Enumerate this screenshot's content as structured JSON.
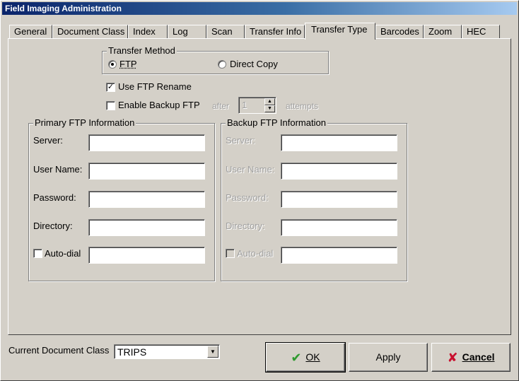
{
  "window": {
    "title": "Field Imaging Administration"
  },
  "tabs": [
    {
      "label": "General"
    },
    {
      "label": "Document Class"
    },
    {
      "label": "Index"
    },
    {
      "label": "Log"
    },
    {
      "label": "Scan"
    },
    {
      "label": "Transfer Info"
    },
    {
      "label": "Transfer Type",
      "active": true
    },
    {
      "label": "Barcodes"
    },
    {
      "label": "Zoom"
    },
    {
      "label": "HEC"
    }
  ],
  "transfer_method": {
    "title": "Transfer Method",
    "options": [
      "FTP",
      "Direct Copy"
    ],
    "selected": "FTP"
  },
  "use_ftp_rename": {
    "label": "Use FTP Rename",
    "checked": true
  },
  "enable_backup": {
    "label": "Enable Backup FTP",
    "checked": false,
    "after_label": "after",
    "attempts_value": "1",
    "attempts_label": "attempts"
  },
  "primary": {
    "title": "Primary FTP Information",
    "server_label": "Server:",
    "username_label": "User Name:",
    "password_label": "Password:",
    "directory_label": "Directory:",
    "autodial_label": "Auto-dial",
    "server": "",
    "username": "",
    "password": "",
    "directory": "",
    "autodial_value": ""
  },
  "backup": {
    "title": "Backup FTP Information",
    "server_label": "Server:",
    "username_label": "User Name:",
    "password_label": "Password:",
    "directory_label": "Directory:",
    "autodial_label": "Auto-dial",
    "server": "",
    "username": "",
    "password": "",
    "directory": "",
    "autodial_value": ""
  },
  "footer": {
    "doc_class_label": "Current Document Class",
    "doc_class_value": "TRIPS",
    "ok_label": "OK",
    "apply_label": "Apply",
    "cancel_label": "Cancel"
  }
}
